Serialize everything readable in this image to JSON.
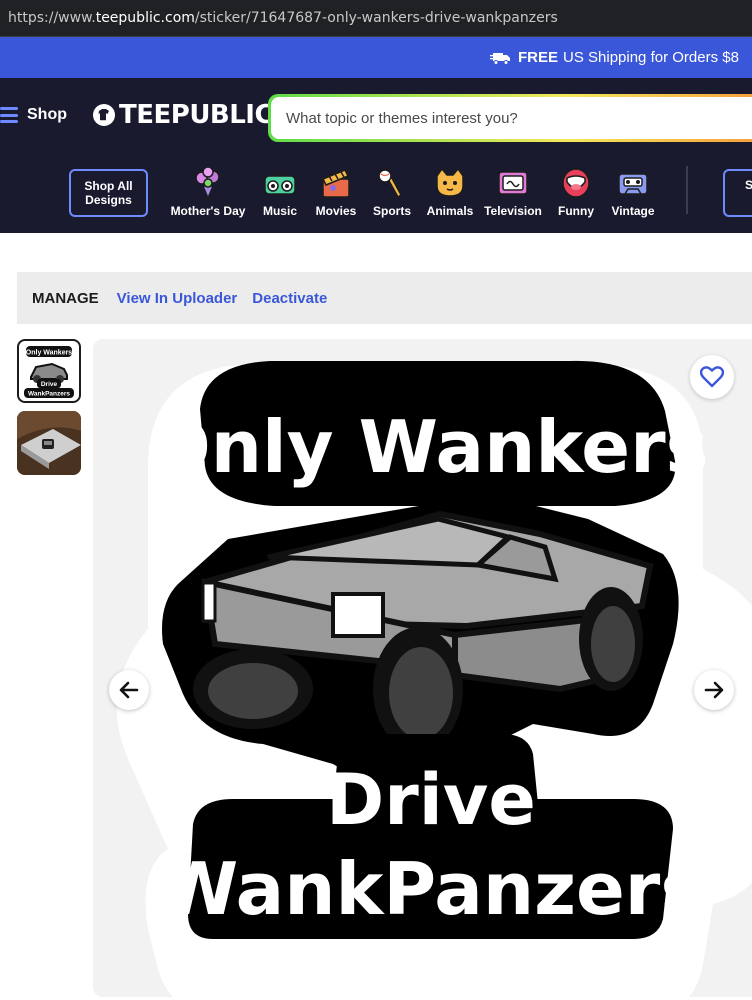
{
  "browser": {
    "url_prefix": "https://www.",
    "url_host": "teepublic.com",
    "url_path": "/sticker/71647687-only-wankers-drive-wankpanzers"
  },
  "promo": {
    "bold": "FREE",
    "text": "US Shipping for Orders $8"
  },
  "header": {
    "menu_label": "Shop",
    "logo_text": "TEEPUBLIC",
    "search_placeholder": "What topic or themes interest you?",
    "shop_all_label": "Shop All Designs",
    "right_button_label": "S Pr",
    "categories": [
      {
        "label": "Mother's Day",
        "icon": "flower-bouquet-icon"
      },
      {
        "label": "Music",
        "icon": "boombox-icon"
      },
      {
        "label": "Movies",
        "icon": "clapperboard-icon"
      },
      {
        "label": "Sports",
        "icon": "bat-ball-icon"
      },
      {
        "label": "Animals",
        "icon": "cat-icon"
      },
      {
        "label": "Television",
        "icon": "tv-icon"
      },
      {
        "label": "Funny",
        "icon": "laughing-mouth-icon"
      },
      {
        "label": "Vintage",
        "icon": "cassette-icon"
      }
    ]
  },
  "manage": {
    "title": "MANAGE",
    "view_in_uploader": "View In Uploader",
    "deactivate": "Deactivate"
  },
  "product": {
    "sticker_text_top": "Only Wankers",
    "sticker_text_middle": "Drive",
    "sticker_text_bottom": "WankPanzers",
    "thumb_text_top": "Only Wankers",
    "thumb_text_middle": "Drive",
    "thumb_text_bottom": "WankPanzers"
  },
  "colors": {
    "promo_bg": "#3b57d9",
    "header_bg": "#191a2e",
    "accent": "#6d8bff",
    "link": "#3b57d9"
  }
}
